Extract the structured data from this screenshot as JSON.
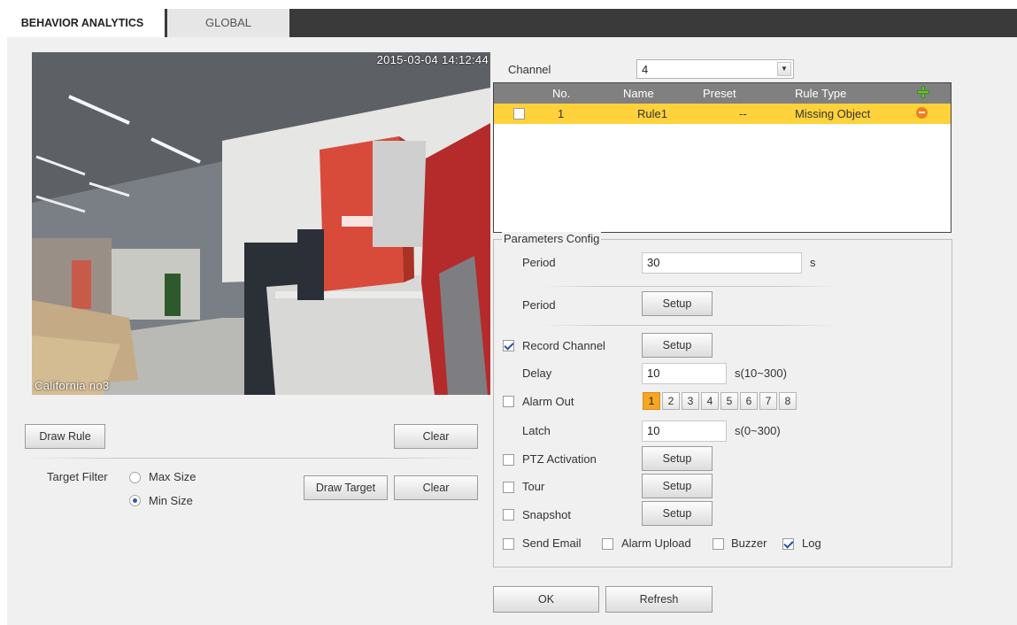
{
  "tabs": [
    {
      "label": "BEHAVIOR ANALYTICS",
      "active": true
    },
    {
      "label": "GLOBAL",
      "active": false
    }
  ],
  "video": {
    "timestamp": "2015-03-04 14:12:44",
    "channel_name": "California  no3"
  },
  "left_panel": {
    "draw_rule": "Draw Rule",
    "clear": "Clear",
    "target_filter_label": "Target Filter",
    "max_size": "Max Size",
    "min_size": "Min Size",
    "selected_size": "Min Size",
    "draw_target": "Draw Target",
    "clear2": "Clear"
  },
  "channel": {
    "label": "Channel",
    "value": "4"
  },
  "rules_table": {
    "headers": [
      "No.",
      "Name",
      "Preset",
      "Rule Type"
    ],
    "rows": [
      {
        "checked": false,
        "no": "1",
        "name": "Rule1",
        "preset": "--",
        "rule_type": "Missing Object"
      }
    ]
  },
  "params": {
    "legend": "Parameters Config",
    "period_label": "Period",
    "period_value": "30",
    "period_unit": "s",
    "period2_label": "Period",
    "setup": "Setup",
    "record_channel": {
      "label": "Record Channel",
      "checked": true
    },
    "delay_label": "Delay",
    "delay_value": "10",
    "delay_unit": "s(10~300)",
    "alarm_out": {
      "label": "Alarm Out",
      "checked": false
    },
    "alarm_channels": [
      "1",
      "2",
      "3",
      "4",
      "5",
      "6",
      "7",
      "8"
    ],
    "alarm_selected": "1",
    "latch_label": "Latch",
    "latch_value": "10",
    "latch_unit": "s(0~300)",
    "ptz_activation": {
      "label": "PTZ Activation",
      "checked": false
    },
    "tour": {
      "label": "Tour",
      "checked": false
    },
    "snapshot": {
      "label": "Snapshot",
      "checked": false
    },
    "send_email": {
      "label": "Send Email",
      "checked": false
    },
    "alarm_upload": {
      "label": "Alarm Upload",
      "checked": false
    },
    "buzzer": {
      "label": "Buzzer",
      "checked": false
    },
    "log": {
      "label": "Log",
      "checked": true
    }
  },
  "actions": {
    "ok": "OK",
    "refresh": "Refresh"
  },
  "colors": {
    "tab_bar": "#3a3a3a",
    "panel_bg": "#f0f0f0",
    "selected_row": "#ffd23b",
    "table_header": "#808080",
    "alarm_selected": "#f5a623"
  }
}
